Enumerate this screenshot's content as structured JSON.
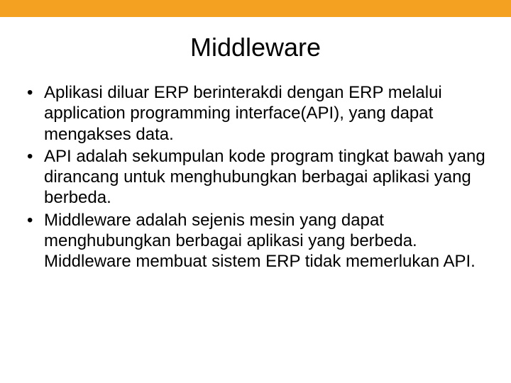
{
  "slide": {
    "title": "Middleware",
    "bullets": [
      "Aplikasi diluar ERP berinterakdi dengan ERP melalui application programming interface(API), yang dapat mengakses data.",
      "API adalah sekumpulan kode program tingkat bawah yang dirancang untuk menghubungkan berbagai aplikasi yang berbeda.",
      "Middleware adalah sejenis mesin yang dapat menghubungkan berbagai aplikasi yang berbeda. Middleware membuat sistem ERP tidak memerlukan API."
    ]
  },
  "colors": {
    "accent": "#f4a020"
  }
}
